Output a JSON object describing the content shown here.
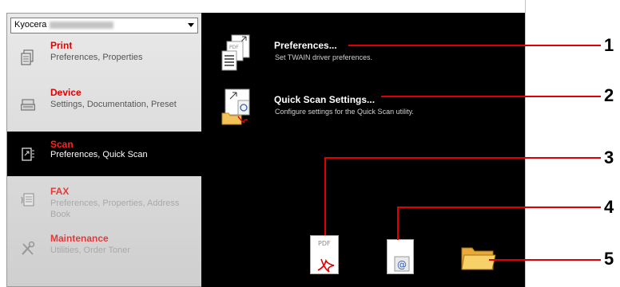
{
  "device_select": {
    "value": "Kyocera"
  },
  "sidebar": {
    "items": [
      {
        "title": "Print",
        "desc": "Preferences, Properties"
      },
      {
        "title": "Device",
        "desc": "Settings, Documentation, Preset"
      },
      {
        "title": "Scan",
        "desc": "Preferences, Quick Scan"
      },
      {
        "title": "FAX",
        "desc": "Preferences, Properties, Address Book"
      },
      {
        "title": "Maintenance",
        "desc": "Utilities, Order Toner"
      }
    ]
  },
  "main": {
    "entries": [
      {
        "title": "Preferences...",
        "desc": "Set TWAIN driver preferences."
      },
      {
        "title": "Quick Scan Settings...",
        "desc": "Configure settings for the Quick Scan utility."
      }
    ],
    "pdf_label": "PDF"
  },
  "callouts": [
    "1",
    "2",
    "3",
    "4",
    "5"
  ],
  "colors": {
    "accent": "#e00000",
    "panel": "#000000"
  }
}
